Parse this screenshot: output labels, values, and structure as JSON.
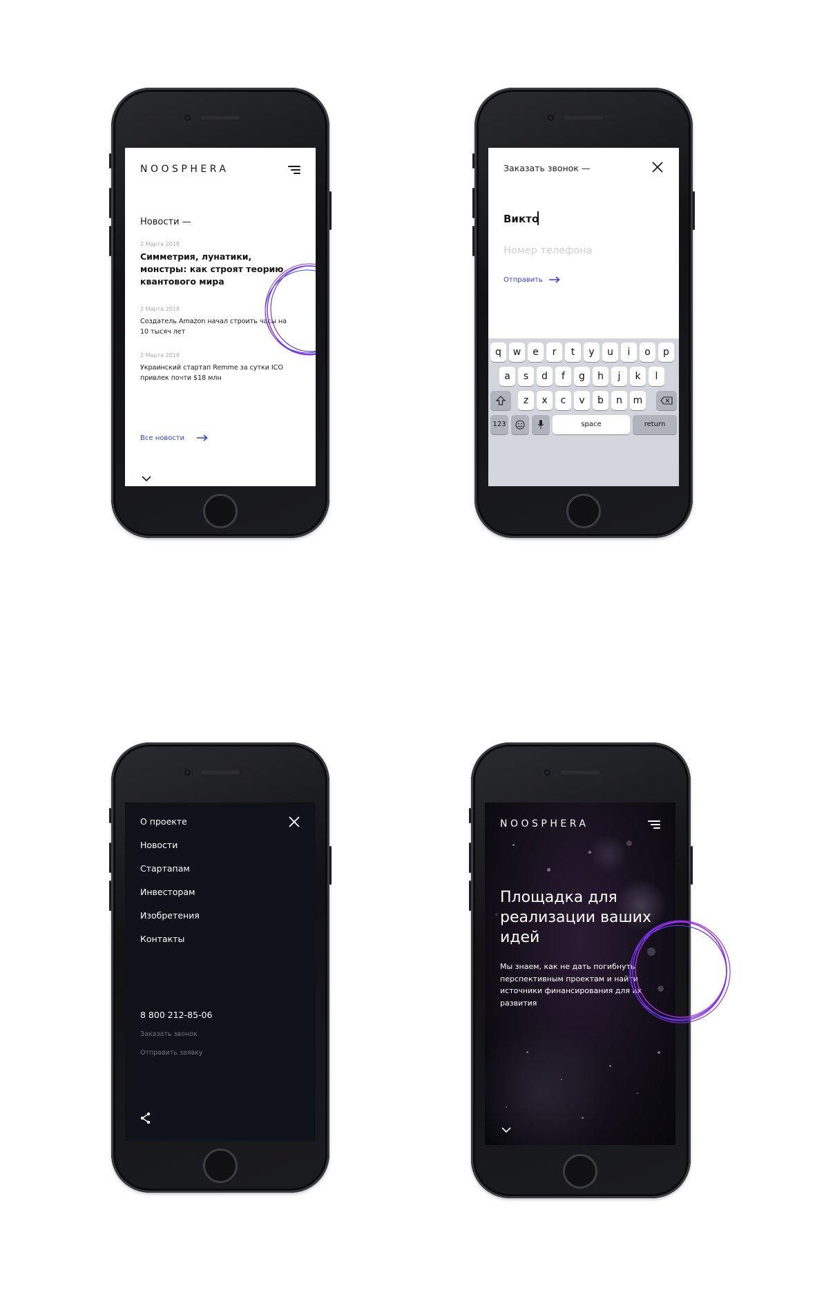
{
  "news_screen": {
    "logo": "NOOSPHERA",
    "section_title": "Новости —",
    "items": [
      {
        "date": "2 Марта 2018",
        "title": "Симметрия, лунатики, монстры: как строят теорию квантового мира"
      },
      {
        "date": "2 Марта 2018",
        "title": "Создатель Amazon начал строить часы на 10 тысяч лет"
      },
      {
        "date": "2 Марта 2018",
        "title": "Украинский стартап Remme за сутки ICO привлек почти $18 млн"
      }
    ],
    "all_news_link": "Все новости"
  },
  "callback_screen": {
    "title": "Заказать звонок —",
    "name_value": "Викто",
    "phone_placeholder": "Номер телефона",
    "submit_label": "Отправить",
    "keyboard": {
      "row1": [
        "q",
        "w",
        "e",
        "r",
        "t",
        "y",
        "u",
        "i",
        "o",
        "p"
      ],
      "row2": [
        "a",
        "s",
        "d",
        "f",
        "g",
        "h",
        "j",
        "k",
        "l"
      ],
      "row3": [
        "z",
        "x",
        "c",
        "v",
        "b",
        "n",
        "m"
      ],
      "numbers_key": "123",
      "space_key": "space",
      "return_key": "return"
    }
  },
  "menu_screen": {
    "items": [
      "О проекте",
      "Новости",
      "Стартапам",
      "Инвесторам",
      "Изобретения",
      "Контакты"
    ],
    "phone_number": "8 800 212-85-06",
    "order_call": "Заказать звонок",
    "send_request": "Отправить заявку"
  },
  "hero_screen": {
    "logo": "NOOSPHERA",
    "headline": "Площадка для реализации ваших идей",
    "description": "Мы знаем, как не дать погибнуть перспективным проектам и найти источники финансирования для их развития"
  },
  "colors": {
    "accent_blue": "#2f3fe0",
    "ring_purple": "#7b2cf0",
    "menu_bg": "#0f1219"
  }
}
